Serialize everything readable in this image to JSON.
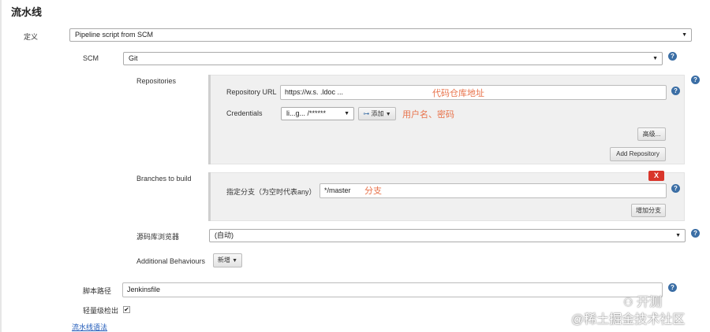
{
  "section_title": "流水线",
  "definition": {
    "label": "定义",
    "value": "Pipeline script from SCM"
  },
  "scm": {
    "label": "SCM",
    "value": "Git"
  },
  "repositories": {
    "label": "Repositories",
    "url_label": "Repository URL",
    "url_value": "https://w.s.               .ldoc      ...",
    "url_annotation": "代码仓库地址",
    "credentials_label": "Credentials",
    "credentials_value": "li...g...  /******",
    "add_label": "添加",
    "credentials_annotation": "用户名、密码",
    "advanced_label": "高级...",
    "add_repo_label": "Add Repository"
  },
  "branches": {
    "label": "Branches to build",
    "delete_label": "X",
    "spec_label": "指定分支（为空时代表any）",
    "spec_value": "*/master",
    "spec_annotation": "分支",
    "add_branch_label": "增加分支"
  },
  "browser": {
    "label": "源码库浏览器",
    "value": "(自动)"
  },
  "behaviours": {
    "label": "Additional Behaviours",
    "add_label": "新增"
  },
  "script_path": {
    "label": "脚本路径",
    "value": "Jenkinsfile"
  },
  "lightweight": {
    "label": "轻量级检出",
    "checked": "✔"
  },
  "syntax_link": "流水线语法",
  "watermark": {
    "line1": "开测",
    "line2": "@稀土掘金技术社区"
  },
  "help_icon": "?"
}
